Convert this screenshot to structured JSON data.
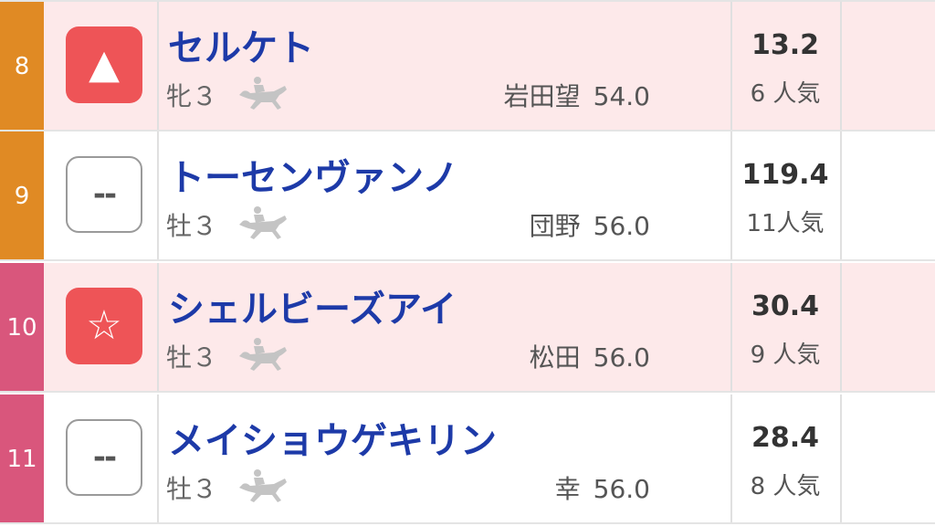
{
  "colors": {
    "post_orange": "#e08a24",
    "post_pink": "#d9567c",
    "mark_red": "#ee5457",
    "name_blue": "#1d3aa8",
    "row_highlight": "#fde9ea"
  },
  "horses": [
    {
      "post": "8",
      "post_color": "#e08a24",
      "highlight": true,
      "mark": {
        "glyph": "▲",
        "style": "filled",
        "icon": "triangle-mark-icon"
      },
      "name": "セルケト",
      "sexage": "牝３",
      "jockey": "岩田望",
      "weight": "54.0",
      "odds": "13.2",
      "popularity": "6 人気"
    },
    {
      "post": "9",
      "post_color": "#e08a24",
      "highlight": false,
      "mark": {
        "glyph": "--",
        "style": "empty",
        "icon": "no-mark-icon"
      },
      "name": "トーセンヴァンノ",
      "sexage": "牡３",
      "jockey": "団野",
      "weight": "56.0",
      "odds": "119.4",
      "popularity": "11人気"
    },
    {
      "post": "10",
      "post_color": "#d9567c",
      "highlight": true,
      "mark": {
        "glyph": "☆",
        "style": "filled",
        "icon": "star-mark-icon"
      },
      "name": "シェルビーズアイ",
      "sexage": "牡３",
      "jockey": "松田",
      "weight": "56.0",
      "odds": "30.4",
      "popularity": "9 人気"
    },
    {
      "post": "11",
      "post_color": "#d9567c",
      "highlight": false,
      "mark": {
        "glyph": "--",
        "style": "empty",
        "icon": "no-mark-icon"
      },
      "name": "メイショウゲキリン",
      "sexage": "牡３",
      "jockey": "幸",
      "weight": "56.0",
      "odds": "28.4",
      "popularity": "8 人気"
    }
  ]
}
